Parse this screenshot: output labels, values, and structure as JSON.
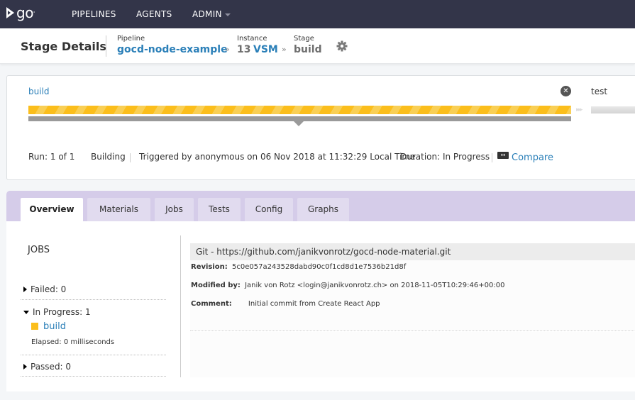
{
  "nav": {
    "logo": "go",
    "items": [
      {
        "label": "PIPELINES"
      },
      {
        "label": "AGENTS"
      },
      {
        "label": "ADMIN"
      }
    ]
  },
  "header": {
    "title": "Stage Details",
    "breadcrumbs": {
      "pipeline_label": "Pipeline",
      "pipeline_value": "gocd-node-example",
      "instance_label": "Instance",
      "instance_number": "13",
      "instance_vsm": "VSM",
      "stage_label": "Stage",
      "stage_value": "build",
      "separator": "»"
    },
    "settings_icon": "gear-icon"
  },
  "stage_bar": {
    "current_stage": "build",
    "current_status": "building",
    "next_stage": "test",
    "cancel_icon": "close-icon",
    "arrows": "▸▸▸"
  },
  "run_info": {
    "run": "Run: 1 of 1",
    "status": "Building",
    "triggered": "Triggered by anonymous on 06 Nov 2018 at 11:32:29 Local Time",
    "duration": "Duration: In Progress",
    "compare_label": "Compare",
    "compare_icon": "compare-icon"
  },
  "tabs": [
    {
      "label": "Overview",
      "active": true
    },
    {
      "label": "Materials"
    },
    {
      "label": "Jobs"
    },
    {
      "label": "Tests"
    },
    {
      "label": "Config"
    },
    {
      "label": "Graphs"
    }
  ],
  "jobs": {
    "title": "JOBS",
    "failed": "Failed: 0",
    "in_progress": "In Progress: 1",
    "in_progress_jobs": [
      {
        "name": "build",
        "elapsed": "Elapsed: 0 milliseconds",
        "color": "#fbbe1c"
      }
    ],
    "passed": "Passed: 0"
  },
  "material": {
    "header": "Git - https://github.com/janikvonrotz/gocd-node-material.git",
    "revision_label": "Revision:",
    "revision": "5c0e057a243528dabd90c0f1cd8d1e7536b21d8f",
    "modified_label": "Modified by:",
    "modified": "Janik von Rotz <login@janikvonrotz.ch> on 2018-11-05T10:29:46+00:00",
    "comment_label": "Comment:",
    "comment": "Initial commit from Create React App"
  },
  "colors": {
    "nav_bg": "#333549",
    "link": "#2a7fb8",
    "building": "#fbbe1c",
    "tabs_bg": "#d5cce9"
  }
}
